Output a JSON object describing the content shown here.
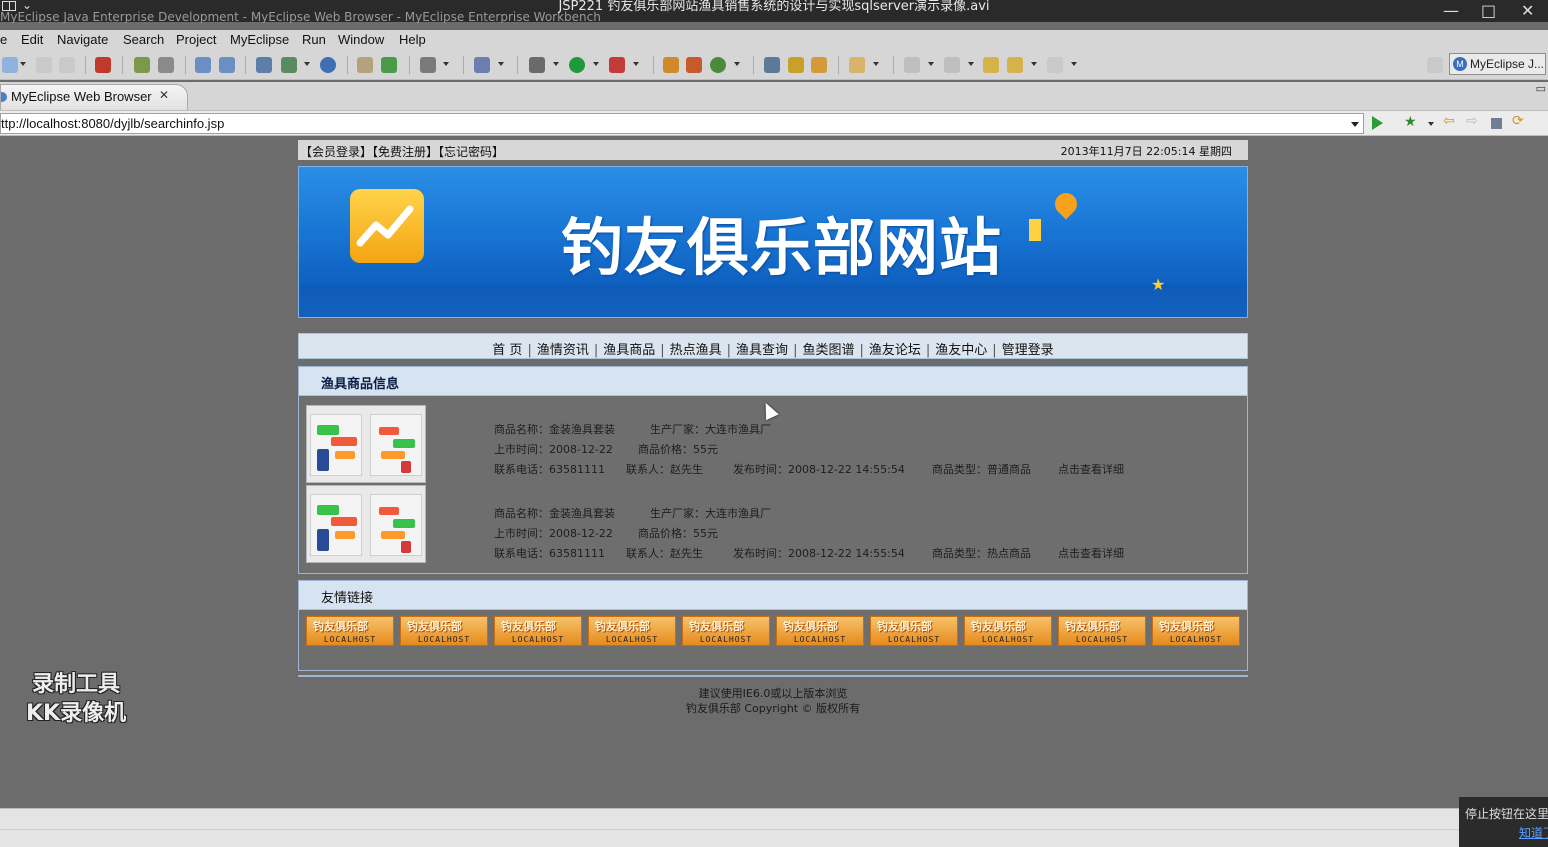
{
  "window": {
    "title": "JSP221 钓友俱乐部网站渔具销售系统的设计与实现sqlserver演示录像.avi",
    "subtitle": "MyEclipse Java Enterprise Development - MyEclipse Web Browser - MyEclipse Enterprise Workbench",
    "controls": [
      "—",
      "□",
      "✕"
    ]
  },
  "menu": [
    "e",
    "Edit",
    "Navigate",
    "Search",
    "Project",
    "MyEclipse",
    "Run",
    "Window",
    "Help"
  ],
  "toolbar": {
    "perspective_label": "MyEclipse J...",
    "perspective_icon": "M"
  },
  "tab": {
    "label": "MyEclipse Web Browser",
    "close": "✕"
  },
  "address": {
    "url": "ttp://localhost:8080/dyjlb/searchinfo.jsp"
  },
  "site": {
    "top_links": "【会员登录】【免费注册】【忘记密码】",
    "datetime": "2013年11月7日 22:05:14  星期四",
    "banner_title": "钓友俱乐部网站",
    "nav": [
      "首 页",
      "渔情资讯",
      "渔具商品",
      "热点渔具",
      "渔具查询",
      "鱼类图谱",
      "渔友论坛",
      "渔友中心",
      "管理登录"
    ],
    "nav_sep": "|",
    "products_heading": "渔具商品信息",
    "products": [
      {
        "name": "商品名称：金装渔具套装",
        "maker": "生产厂家：大连市渔具厂",
        "launch": "上市时间：2008-12-22",
        "price": "商品价格：55元",
        "phone": "联系电话：63581111",
        "contact": "联系人：赵先生",
        "posted": "发布时间：2008-12-22 14:55:54",
        "type": "商品类型：普通商品",
        "detail": "点击查看详细"
      },
      {
        "name": "商品名称：金装渔具套装",
        "maker": "生产厂家：大连市渔具厂",
        "launch": "上市时间：2008-12-22",
        "price": "商品价格：55元",
        "phone": "联系电话：63581111",
        "contact": "联系人：赵先生",
        "posted": "发布时间：2008-12-22 14:55:54",
        "type": "商品类型：热点商品",
        "detail": "点击查看详细"
      }
    ],
    "friends_heading": "友情链接",
    "friend_link_title": "钓友俱乐部",
    "friend_link_sub": "LOCALHOST",
    "friend_link_count": 10,
    "footer_line1": "建议使用IE6.0或以上版本浏览",
    "footer_line2": "钓友俱乐部 Copyright © 版权所有"
  },
  "watermark": {
    "line1": "录制工具",
    "line2": "KK录像机"
  },
  "popup": {
    "text": "停止按钮在这里",
    "link": "知道了"
  },
  "colors": {
    "banner": "#1874d3",
    "nav_bg": "#dbe5f0",
    "section_head": "#d6e3f1",
    "friend_badge": "#e58a1c"
  }
}
